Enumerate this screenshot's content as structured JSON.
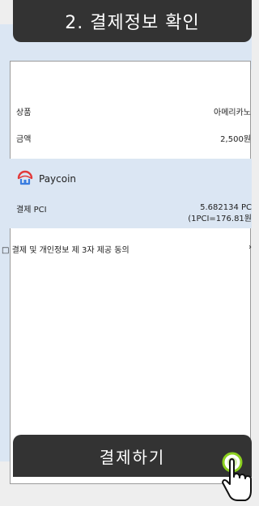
{
  "header": {
    "title": "2. 결제정보 확인"
  },
  "product": {
    "label": "상품",
    "value": "아메리카노"
  },
  "amount": {
    "label": "금액",
    "value": "2,500원"
  },
  "payment": {
    "provider": "Paycoin",
    "pci_label": "결제 PCI",
    "pci_amount": "5.682134 PC",
    "pci_rate": "(1PCI=176.81원"
  },
  "agreement": {
    "checkbox": "□",
    "label": "결제 및 개인정보 제 3자 제공 동의",
    "arrow": "›"
  },
  "action": {
    "pay_label": "결제하기"
  },
  "icons": {
    "provider_icon": "paycoin-icon",
    "pointer": "hand-cursor-icon"
  },
  "colors": {
    "header_bg": "#333333",
    "band_bg": "#dbe6f3",
    "paycoin_red": "#e23a3a",
    "paycoin_blue": "#3a7de0",
    "cursor_ring": "#8cd01f"
  }
}
